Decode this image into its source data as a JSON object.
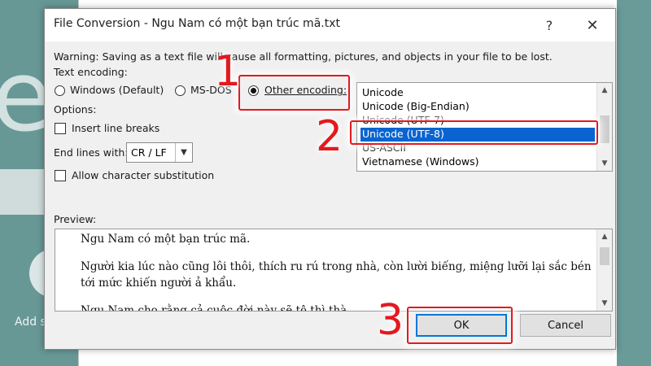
{
  "background": {
    "letter": "e",
    "add_text": "Add s"
  },
  "dialog": {
    "title": "File Conversion - Ngu Nam có một bạn trúc mã.txt",
    "help_label": "?",
    "close_label": "✕",
    "warning": "Warning: Saving as a text file will cause all formatting, pictures, and objects in your file to be lost.",
    "text_encoding_label": "Text encoding:",
    "radio_windows": "Windows (Default)",
    "radio_msdos": "MS-DOS",
    "radio_other": "Other encoding:",
    "selected_radio": "other",
    "options_label": "Options:",
    "insert_line_breaks": "Insert line breaks",
    "end_lines_label": "End lines with:",
    "end_lines_value": "CR / LF",
    "allow_substitution": "Allow character substitution",
    "preview_label": "Preview:",
    "encodings": [
      "Unicode",
      "Unicode (Big-Endian)",
      "Unicode (UTF-7)",
      "Unicode (UTF-8)",
      "US-ASCII",
      "Vietnamese (Windows)"
    ],
    "selected_encoding": "Unicode (UTF-8)",
    "preview_lines": [
      "Ngu Nam có một bạn trúc mã.",
      "Người kia lúc nào cũng lôi thôi, thích ru rú trong nhà, còn lười biếng, miệng lưỡi lại sắc bén",
      "tới mức khiến người ả khẩu.",
      "Ngu Nam cho rằng cả cuộc đời này sẽ tệ thì thà..."
    ],
    "ok_label": "OK",
    "cancel_label": "Cancel"
  },
  "annotations": {
    "step1": "1",
    "step2": "2",
    "step3": "3",
    "highlight_color": "#e3191e"
  },
  "colors": {
    "selection": "#0a64d0",
    "ok_border": "#0078d7"
  }
}
